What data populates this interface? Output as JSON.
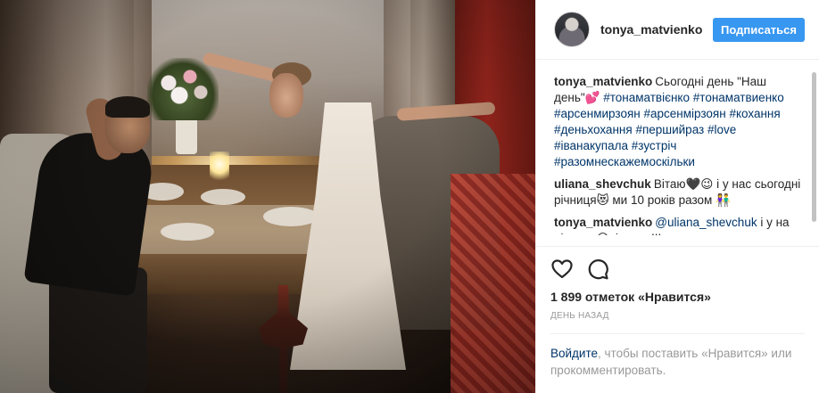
{
  "header": {
    "username": "tonya_matvienko",
    "follow_label": "Подписаться"
  },
  "comments": [
    {
      "author": "tonya_matvienko",
      "parts": [
        {
          "t": "text",
          "v": "Сьогодні день \"Наш день\"💕 "
        },
        {
          "t": "tag",
          "v": "#тонаматвієнко"
        },
        {
          "t": "text",
          "v": " "
        },
        {
          "t": "tag",
          "v": "#тонаматвиенко"
        },
        {
          "t": "text",
          "v": " "
        },
        {
          "t": "tag",
          "v": "#арсенмирзоян"
        },
        {
          "t": "text",
          "v": " "
        },
        {
          "t": "tag",
          "v": "#арсенмірзоян"
        },
        {
          "t": "text",
          "v": " "
        },
        {
          "t": "tag",
          "v": "#кохання"
        },
        {
          "t": "text",
          "v": " "
        },
        {
          "t": "tag",
          "v": "#деньхохання"
        },
        {
          "t": "text",
          "v": " "
        },
        {
          "t": "tag",
          "v": "#першийраз"
        },
        {
          "t": "text",
          "v": " "
        },
        {
          "t": "tag",
          "v": "#love"
        },
        {
          "t": "text",
          "v": " "
        },
        {
          "t": "tag",
          "v": "#іванакупала"
        },
        {
          "t": "text",
          "v": " "
        },
        {
          "t": "tag",
          "v": "#зустріч"
        },
        {
          "t": "text",
          "v": " "
        },
        {
          "t": "tag",
          "v": "#разомнескажемоскільки"
        }
      ]
    },
    {
      "author": "uliana_shevchuk",
      "parts": [
        {
          "t": "text",
          "v": "Вітаю🖤😉 і у нас сьогодні річниця😻 ми 10 років разом 👫"
        }
      ]
    },
    {
      "author": "tonya_matvienko",
      "parts": [
        {
          "t": "mention",
          "v": "@uliana_shevchuk"
        },
        {
          "t": "text",
          "v": " і у на річниця😆вітаємо!!!"
        }
      ]
    }
  ],
  "actions": {
    "likes_text": "1 899 отметок «Нравится»",
    "time_text": "ДЕНЬ НАЗАД",
    "like_icon": "heart-outline-icon",
    "comment_icon": "speech-bubble-icon"
  },
  "login": {
    "login_link": "Войдите",
    "prompt_text": ", чтобы поставить «Нравится» или прокомментировать."
  },
  "colors": {
    "accent": "#3897f0",
    "link": "#003569",
    "muted": "#999999"
  }
}
